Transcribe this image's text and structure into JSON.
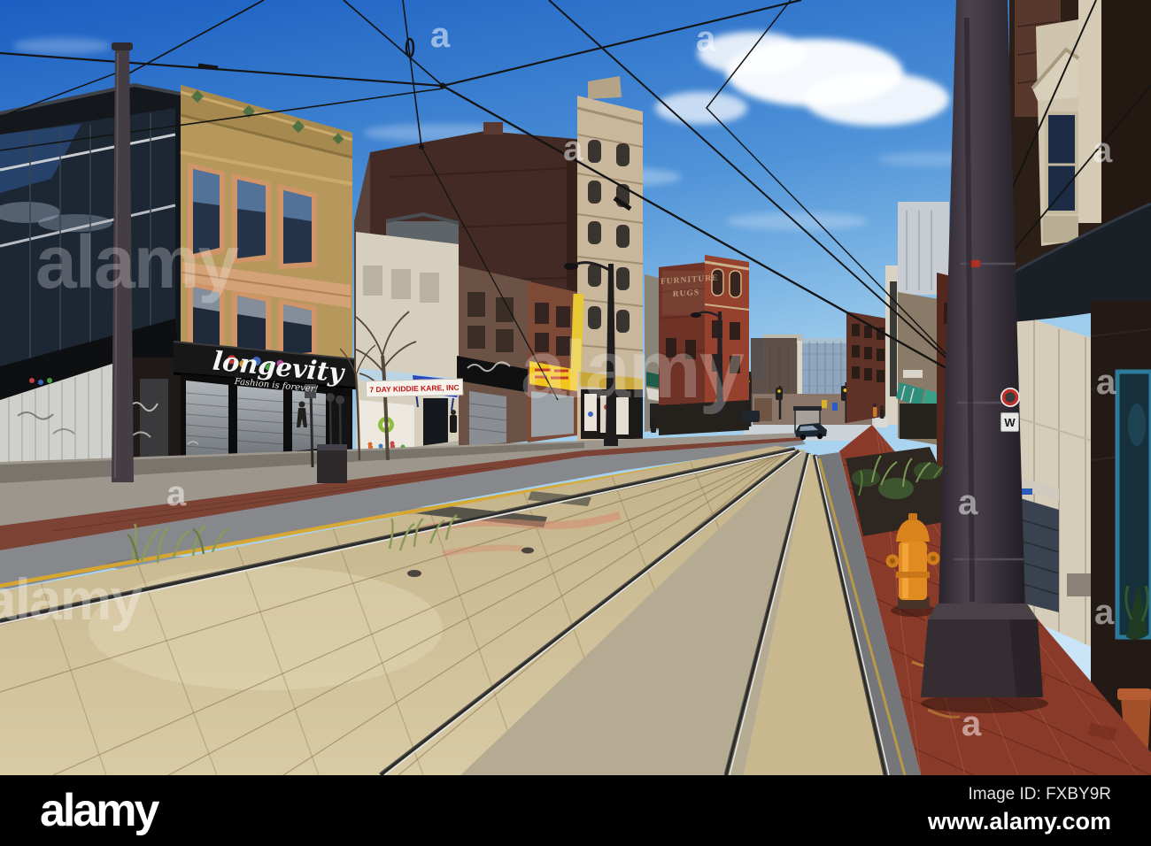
{
  "photo": {
    "description": "Empty city street with embedded light rail tracks, shuttered storefronts, overhead catenary wires, an orange fire hydrant and red brick sidewalks under a blue sky",
    "signs": {
      "awning_title": "longevity",
      "awning_tagline": "Fashion is forever!",
      "daycare": "7 DAY KIDDIE KARE, INC",
      "ghost_line1": "FURNITURE",
      "ghost_line2": "RUGS",
      "pole_sign": "W"
    },
    "colors": {
      "sky_top": "#1a5ec2",
      "sky_horizon": "#aed5f0",
      "tan_building": "#b6985c",
      "awning_black": "#171717",
      "blue_awning": "#2a46b8",
      "ghost_brick": "#6e3226",
      "track_bed": "#cdbc92",
      "asphalt": "#86888c",
      "yellow_line": "#d9a62e",
      "sidewalk_brick": "#8a3a28",
      "hydrant_orange": "#e08a1f",
      "pole_gray": "#3a333c",
      "footer_bar": "#000000"
    }
  },
  "watermark": {
    "brand": "alamy",
    "tile_letter": "a"
  },
  "footer": {
    "logo": "alamy",
    "image_id": "Image ID: FXBY9R",
    "website": "www.alamy.com"
  }
}
